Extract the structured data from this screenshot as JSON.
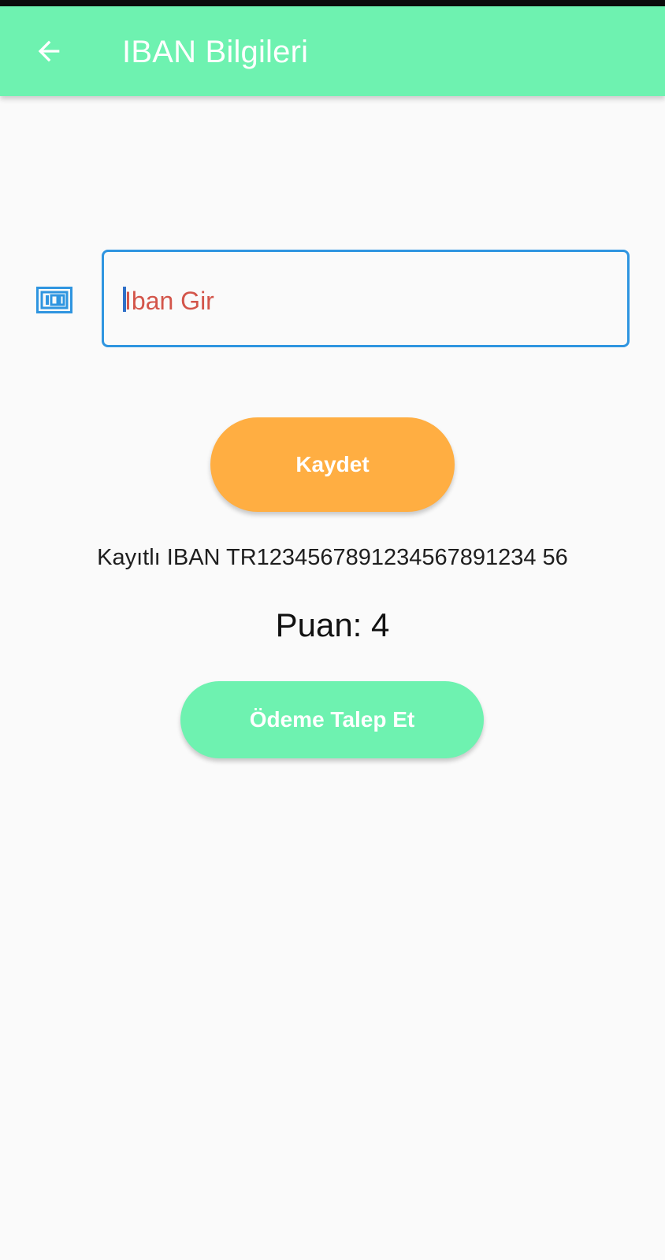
{
  "app_bar": {
    "title": "IBAN Bilgileri",
    "back_icon": "arrow-back-icon",
    "background_color": "#6ef2b0"
  },
  "iban_form": {
    "icon": "money-icon",
    "input_placeholder": "Iban Gir",
    "input_value": "",
    "border_color": "#2f95e0"
  },
  "save_button": {
    "label": "Kaydet",
    "color": "#ffae42"
  },
  "saved_iban": {
    "text": "Kayıtlı IBAN TR1234567891234567891234 56"
  },
  "points": {
    "text": "Puan: 4"
  },
  "payment_button": {
    "label": "Ödeme Talep Et",
    "color": "#6ef2b0"
  }
}
